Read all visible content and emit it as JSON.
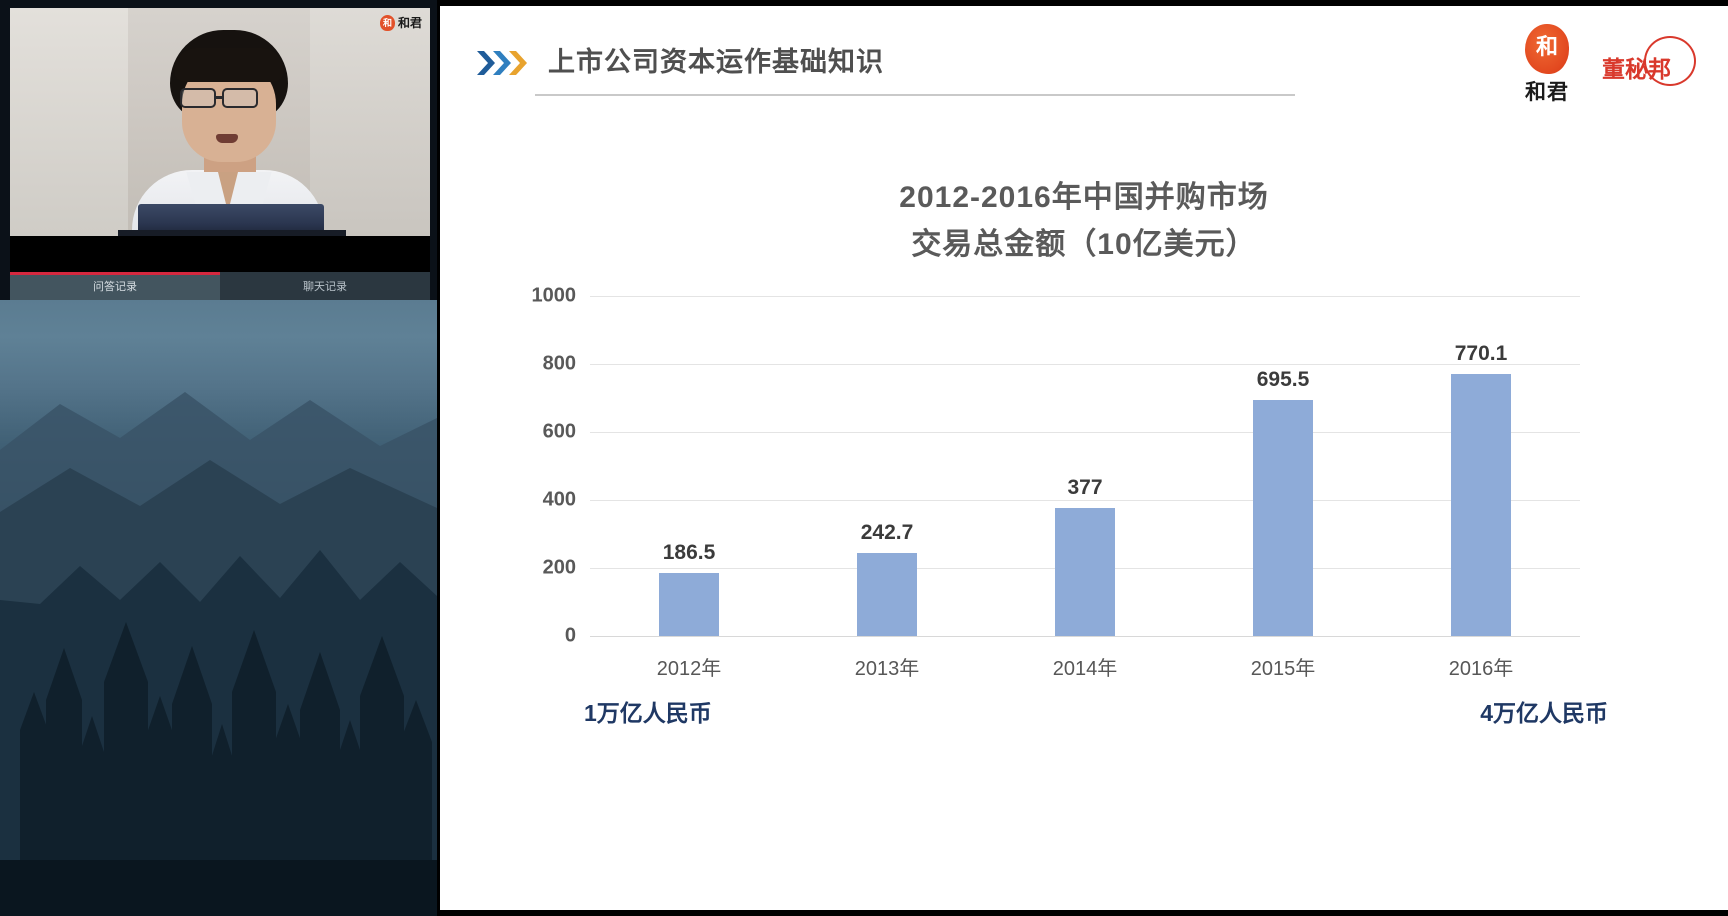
{
  "left_panel": {
    "video": {
      "watermark_seal": "和",
      "watermark_text": "和君"
    },
    "tabs": [
      {
        "label": "问答记录",
        "active": true
      },
      {
        "label": "聊天记录",
        "active": false
      }
    ]
  },
  "slide": {
    "header": {
      "title": "上市公司资本运作基础知识",
      "chevrons_icon": "triple-chevron-right-icon",
      "chevron_colors": [
        "#1f5c99",
        "#2f7fbf",
        "#e8a32e"
      ],
      "logo_hejun_seal": "和",
      "logo_hejun_text": "和君",
      "logo_dongmibang_text": "董秘邦",
      "logo_hejun_color": "#e2481f",
      "logo_dongmibang_color": "#d9392c"
    }
  },
  "chart_data": {
    "type": "bar",
    "title": "2012-2016年中国并购市场",
    "subtitle": "交易总金额（10亿美元）",
    "title_lines": [
      "2012-2016年中国并购市场",
      "交易总金额（10亿美元）"
    ],
    "categories": [
      "2012年",
      "2013年",
      "2014年",
      "2015年",
      "2016年"
    ],
    "values": [
      186.5,
      242.7,
      377,
      695.5,
      770.1
    ],
    "value_labels": [
      "186.5",
      "242.7",
      "377",
      "695.5",
      "770.1"
    ],
    "yticks": [
      1000,
      800,
      600,
      400,
      200,
      0
    ],
    "ytick_labels": [
      "1000",
      "800",
      "600",
      "400",
      "200",
      "0"
    ],
    "ylim": [
      0,
      1000
    ],
    "xlabel": "",
    "ylabel": "",
    "grid": true,
    "legend": false,
    "bar_color": "#8eabd8",
    "annotations": [
      {
        "text": "1万亿人民币",
        "position": "left",
        "color": "#1f3864"
      },
      {
        "text": "4万亿人民币",
        "position": "right",
        "color": "#1f3864"
      }
    ]
  }
}
